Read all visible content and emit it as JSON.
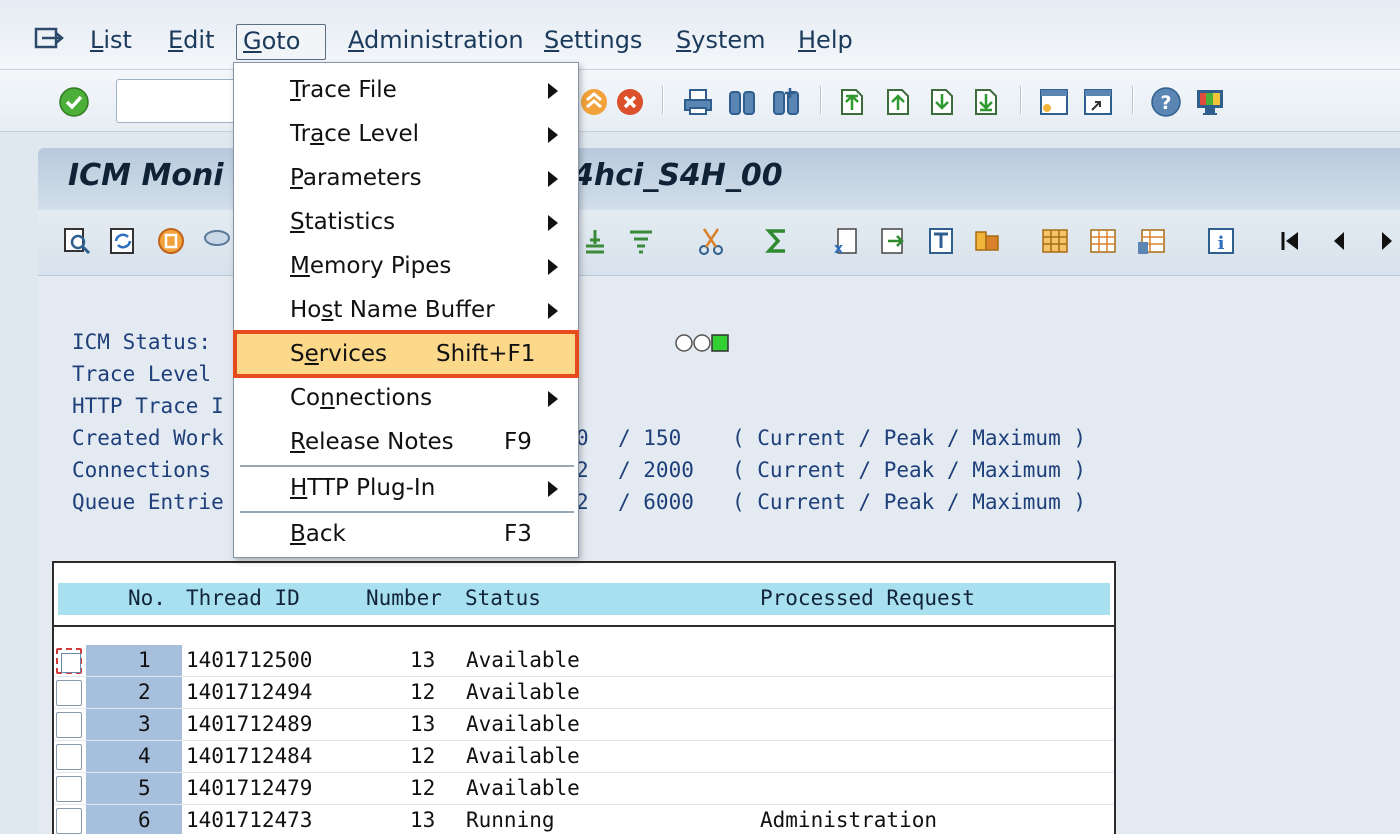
{
  "menubar": {
    "items": [
      {
        "label": "List",
        "ul": "L",
        "rest": "ist"
      },
      {
        "label": "Edit",
        "ul": "E",
        "rest": "dit"
      },
      {
        "label": "Goto",
        "ul": "G",
        "rest": "oto"
      },
      {
        "label": "Administration",
        "ul": "A",
        "rest": "dministration"
      },
      {
        "label": "Settings",
        "ul": "S",
        "rest": "ettings"
      },
      {
        "label": "System",
        "ul": "S",
        "rest": "ystem"
      },
      {
        "label": "Help",
        "ul": "H",
        "rest": "elp"
      }
    ]
  },
  "goto_menu": {
    "items": [
      {
        "pre": "",
        "ul": "T",
        "post": "race File",
        "shortcut": "",
        "submenu": true
      },
      {
        "pre": "Tr",
        "ul": "a",
        "post": "ce Level",
        "shortcut": "",
        "submenu": true
      },
      {
        "pre": "",
        "ul": "P",
        "post": "arameters",
        "shortcut": "",
        "submenu": true
      },
      {
        "pre": "",
        "ul": "S",
        "post": "tatistics",
        "shortcut": "",
        "submenu": true
      },
      {
        "pre": "",
        "ul": "M",
        "post": "emory Pipes",
        "shortcut": "",
        "submenu": true
      },
      {
        "pre": "Ho",
        "ul": "s",
        "post": "t Name Buffer",
        "shortcut": "",
        "submenu": true
      },
      {
        "pre": "S",
        "ul": "e",
        "post": "rvices",
        "shortcut": "Shift+F1",
        "submenu": false,
        "highlighted": true
      },
      {
        "pre": "Co",
        "ul": "n",
        "post": "nections",
        "shortcut": "",
        "submenu": true
      },
      {
        "pre": "",
        "ul": "R",
        "post": "elease Notes",
        "shortcut": "F9",
        "submenu": false
      },
      {
        "pre": "",
        "ul": "H",
        "post": "TTP Plug-In",
        "shortcut": "",
        "submenu": true
      },
      {
        "pre": "",
        "ul": "B",
        "post": "ack",
        "shortcut": "F3",
        "submenu": false
      }
    ]
  },
  "page": {
    "title_left": "ICM Moni",
    "title_right": "4hci_S4H_00"
  },
  "status": {
    "labels": [
      "ICM Status:",
      "Trace Level",
      "HTTP Trace I",
      "Created Work",
      "Connections",
      "Queue Entrie"
    ],
    "values": [
      {
        "left": "0",
        "max": "/ 150",
        "legend": "( Current / Peak / Maximum )"
      },
      {
        "left": "2",
        "max": "/ 2000",
        "legend": "( Current / Peak / Maximum )"
      },
      {
        "left": "2",
        "max": "/ 6000",
        "legend": "( Current / Peak / Maximum )"
      }
    ]
  },
  "table": {
    "headers": {
      "no": "No.",
      "thread": "Thread ID",
      "number": "Number",
      "status": "Status",
      "request": "Processed Request"
    },
    "rows": [
      {
        "no": "1",
        "thread": "1401712500",
        "number": "13",
        "status": "Available",
        "request": ""
      },
      {
        "no": "2",
        "thread": "1401712494",
        "number": "12",
        "status": "Available",
        "request": ""
      },
      {
        "no": "3",
        "thread": "1401712489",
        "number": "13",
        "status": "Available",
        "request": ""
      },
      {
        "no": "4",
        "thread": "1401712484",
        "number": "12",
        "status": "Available",
        "request": ""
      },
      {
        "no": "5",
        "thread": "1401712479",
        "number": "12",
        "status": "Available",
        "request": ""
      },
      {
        "no": "6",
        "thread": "1401712473",
        "number": "13",
        "status": "Running",
        "request": "Administration"
      }
    ]
  },
  "colors": {
    "highlight": "#fbd88a",
    "highlight_border": "#e64b1d",
    "grid_header": "#a8e0f0",
    "status_text": "#1f3f7a"
  },
  "icons": [
    "menu-icon",
    "enter-check-icon",
    "save-icon",
    "back-icon",
    "cancel-icon",
    "print-icon",
    "find-icon",
    "find-next-icon",
    "first-page-icon",
    "prev-page-icon",
    "next-page-icon",
    "last-page-icon",
    "new-session-icon",
    "shortcut-icon",
    "help-icon",
    "customize-layout-icon"
  ]
}
